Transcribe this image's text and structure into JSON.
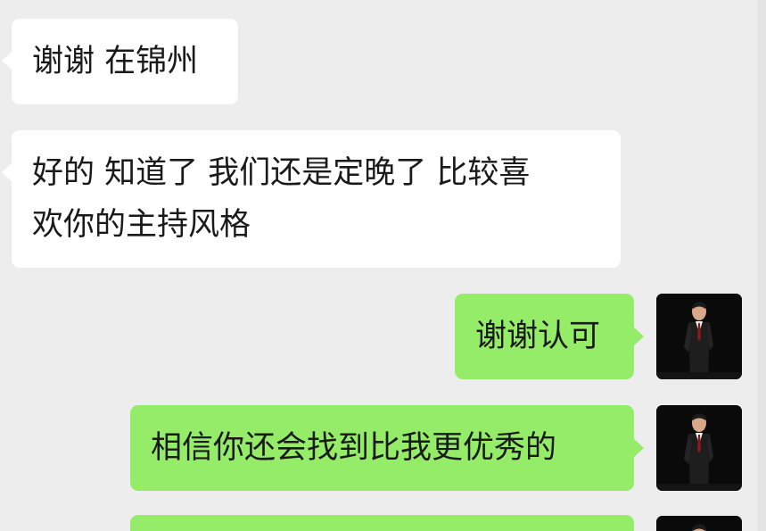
{
  "colors": {
    "background": "#ededed",
    "incoming_bubble": "#ffffff",
    "outgoing_bubble": "#95ec69",
    "text": "#1a1a1a"
  },
  "messages": [
    {
      "direction": "incoming",
      "lines": [
        "谢谢 在锦州"
      ]
    },
    {
      "direction": "incoming",
      "lines": [
        "好的 知道了 我们还是定晚了 比较喜",
        "欢你的主持风格"
      ]
    },
    {
      "direction": "outgoing",
      "lines": [
        "谢谢认可"
      ],
      "avatar": "avatar-man-in-suit-icon"
    },
    {
      "direction": "outgoing",
      "lines": [
        "相信你还会找到比我更优秀的"
      ],
      "avatar": "avatar-man-in-suit-icon"
    },
    {
      "direction": "outgoing",
      "lines": [
        ""
      ],
      "avatar": "avatar-man-in-suit-icon"
    }
  ]
}
